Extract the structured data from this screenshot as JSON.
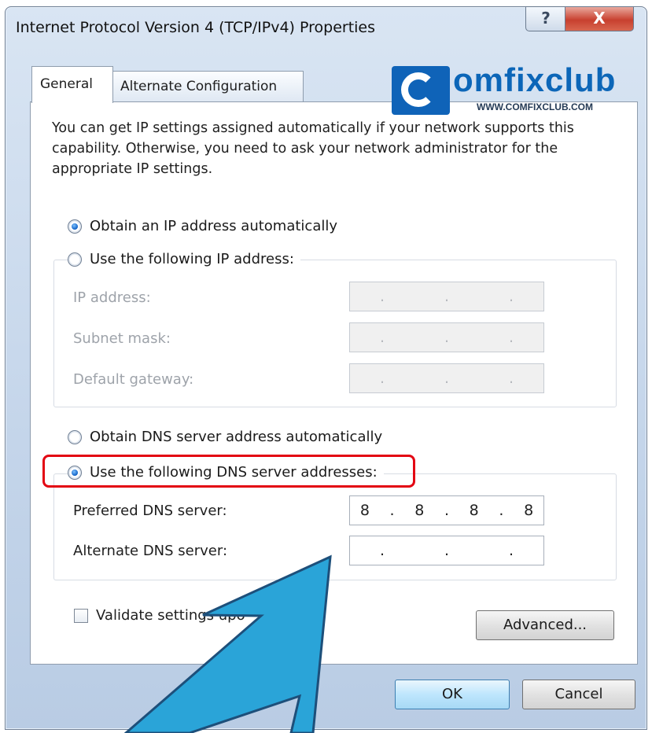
{
  "window": {
    "title": "Internet Protocol Version 4 (TCP/IPv4) Properties",
    "help_label": "?",
    "close_label": "X"
  },
  "tabs": [
    {
      "label": "General",
      "active": true
    },
    {
      "label": "Alternate Configuration",
      "active": false
    }
  ],
  "watermark": {
    "brand_text": "omfixclub",
    "url_text": "WWW.COMFIXCLUB.COM"
  },
  "intro_text": "You can get IP settings assigned automatically if your network supports this capability. Otherwise, you need to ask your network administrator for the appropriate IP settings.",
  "ip_section": {
    "auto_option": {
      "label": "Obtain an IP address automatically",
      "selected": true
    },
    "manual_option": {
      "label": "Use the following IP address:",
      "selected": false
    },
    "fields": [
      {
        "label": "IP address:",
        "value": [
          ".",
          ".",
          "."
        ]
      },
      {
        "label": "Subnet mask:",
        "value": [
          ".",
          ".",
          "."
        ]
      },
      {
        "label": "Default gateway:",
        "value": [
          ".",
          ".",
          "."
        ]
      }
    ]
  },
  "dns_section": {
    "auto_option": {
      "label": "Obtain DNS server address automatically",
      "selected": false
    },
    "manual_option": {
      "label": "Use the following DNS server addresses:",
      "selected": true
    },
    "preferred": {
      "label": "Preferred DNS server:",
      "octets": [
        "8",
        "8",
        "8",
        "8"
      ]
    },
    "alternate": {
      "label": "Alternate DNS server:",
      "octets": [
        "",
        "",
        "",
        ""
      ]
    }
  },
  "validate_checkbox": {
    "label": "Validate settings upo",
    "checked": false
  },
  "buttons": {
    "advanced": "Advanced...",
    "ok": "OK",
    "cancel": "Cancel"
  },
  "colors": {
    "highlight": "#e30613",
    "arrow": "#2aa4d8",
    "brand": "#0c66b8"
  }
}
